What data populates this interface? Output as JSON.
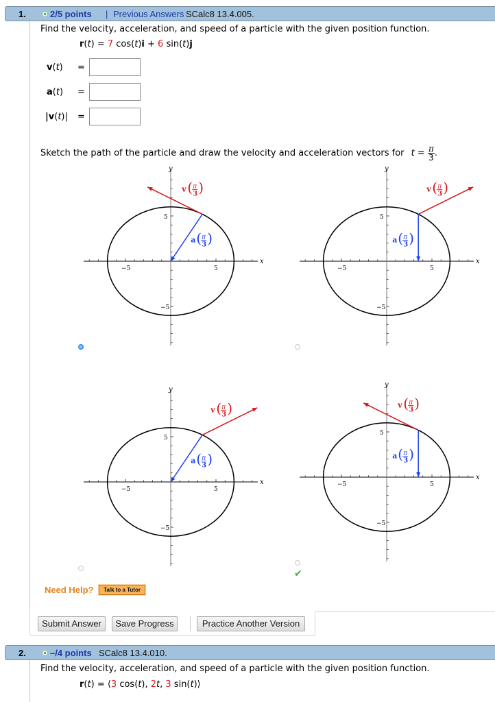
{
  "q1": {
    "number": "1.",
    "points": "2/5 points",
    "separator": "|",
    "previous_answers": "Previous Answers",
    "code": "SCalc8 13.4.005.",
    "prompt": "Find the velocity, acceleration, and speed of a particle with the given position function.",
    "position": {
      "lhs": "r(t) =",
      "c1": "7",
      "f1": "cos(t)i +",
      "c2": "6",
      "f2": "sin(t)j"
    },
    "answers": [
      {
        "label_bold": "v",
        "label_rest": "(t)",
        "eq": "=",
        "value": ""
      },
      {
        "label_bold": "a",
        "label_rest": "(t)",
        "eq": "=",
        "value": ""
      },
      {
        "label_bold": "|v",
        "label_rest": "(t)|",
        "eq": "=",
        "value": ""
      }
    ],
    "sketch_prompt": "Sketch the path of the particle and draw the velocity and acceleration vectors for",
    "t_var": "t =",
    "t_num": "π",
    "t_den": "3",
    "t_end": ".",
    "need_help": "Need Help?",
    "talk_tutor": "Talk to a Tutor",
    "buttons": {
      "submit": "Submit Answer",
      "save": "Save Progress",
      "practice": "Practice Another Version"
    }
  },
  "graph_labels": {
    "x": "x",
    "y": "y",
    "tick_pos": "5",
    "tick_neg": "−5",
    "v_label": "v",
    "a_label": "a",
    "frac_num": "π",
    "frac_den": "3"
  },
  "choices": [
    {
      "id": "top-left",
      "selected": true,
      "correct_mark": false,
      "ellipse": {
        "a": 7,
        "b": 6
      },
      "point": [
        3.5,
        5.196
      ],
      "v": [
        -6.06,
        3.0
      ],
      "a_vec": [
        -3.5,
        -5.196
      ]
    },
    {
      "id": "top-right",
      "selected": false,
      "correct_mark": false,
      "ellipse": {
        "a": 7,
        "b": 6
      },
      "point": [
        3.5,
        5.196
      ],
      "v": [
        6.06,
        3.0
      ],
      "a_vec": [
        0,
        -5.196
      ]
    },
    {
      "id": "bottom-left",
      "selected": false,
      "correct_mark": false,
      "ellipse": {
        "a": 7,
        "b": 6
      },
      "point": [
        3.5,
        5.196
      ],
      "v": [
        6.06,
        3.0
      ],
      "a_vec": [
        -3.5,
        -5.196
      ]
    },
    {
      "id": "bottom-right",
      "selected": false,
      "correct_mark": true,
      "ellipse": {
        "a": 7,
        "b": 6
      },
      "point": [
        3.5,
        5.196
      ],
      "v": [
        -6.06,
        3.0
      ],
      "a_vec": [
        0,
        -5.196
      ]
    }
  ],
  "q2": {
    "number": "2.",
    "points": "–/4 points",
    "code": "SCalc8 13.4.010.",
    "prompt": "Find the velocity, acceleration, and speed of a particle with the given position function.",
    "position": {
      "lhs": "r(t) = ⟨",
      "c1": "3",
      "f1": "cos(t),",
      "c2": "2",
      "f2": "t,",
      "c3": "3",
      "f3": "sin(t)⟩"
    }
  },
  "colors": {
    "header_bg": "#a2c1dd",
    "link": "#1d3ba8",
    "red": "#d8171c",
    "blue": "#1d3ff0",
    "help": "#e8821e"
  }
}
